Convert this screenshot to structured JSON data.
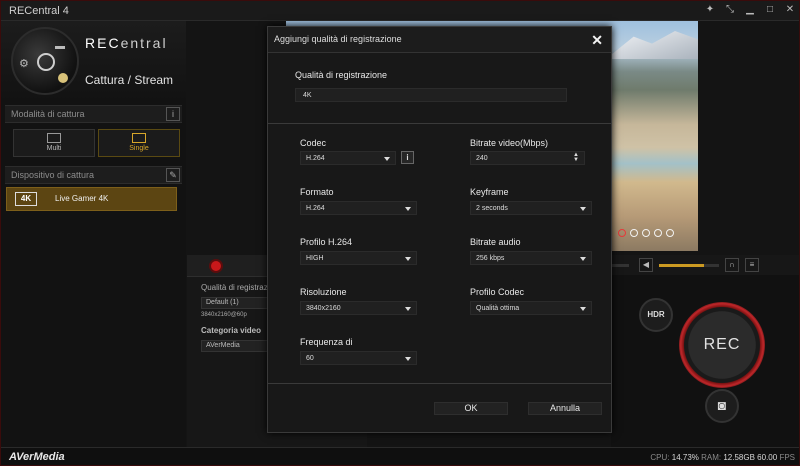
{
  "window": {
    "title": "RECentral 4"
  },
  "brand": {
    "name_prefix": "REC",
    "name_suffix": "entral",
    "mode_label": "Cattura / Stream"
  },
  "left": {
    "capture_mode_heading": "Modalità di cattura",
    "capture_modes": [
      {
        "label": "Multi",
        "active": false
      },
      {
        "label": "Single",
        "active": true
      }
    ],
    "device_heading": "Dispositivo di cattura",
    "device": {
      "badge": "4K",
      "name": "Live Gamer 4K"
    }
  },
  "lower_panel": {
    "quality_label": "Qualità di registraz",
    "quality_value": "Default (1)",
    "quality_detail": "3840x2160@60p",
    "category_label": "Categoria video",
    "category_value": "AVerMedia"
  },
  "rec": {
    "hdr_label": "HDR",
    "rec_label": "REC"
  },
  "status": {
    "brand": "AVerMedia",
    "cpu_label": "CPU:",
    "cpu_value": "14.73%",
    "ram_label": "RAM:",
    "ram_value": "12.58GB",
    "fps_value": "60.00",
    "fps_label": "FPS"
  },
  "volume": {
    "level_1": 0.15,
    "level_2": 0.75
  },
  "dialog": {
    "title": "Aggiungi qualità di registrazione",
    "quality_label": "Qualità di registrazione",
    "quality_value": "4K",
    "codec_label": "Codec",
    "codec_value": "H.264",
    "bitrate_video_label": "Bitrate video(Mbps)",
    "bitrate_video_value": "240",
    "format_label": "Formato",
    "format_value": "H.264",
    "keyframe_label": "Keyframe",
    "keyframe_value": "2 seconds",
    "profile_label": "Profilo H.264",
    "profile_value": "HIGH",
    "bitrate_audio_label": "Bitrate audio",
    "bitrate_audio_value": "256 kbps",
    "resolution_label": "Risoluzione",
    "resolution_value": "3840x2160",
    "codec_profile_label": "Profilo Codec",
    "codec_profile_value": "Qualità ottima",
    "frequency_label": "Frequenza di",
    "frequency_value": "60",
    "ok_label": "OK",
    "cancel_label": "Annulla"
  }
}
